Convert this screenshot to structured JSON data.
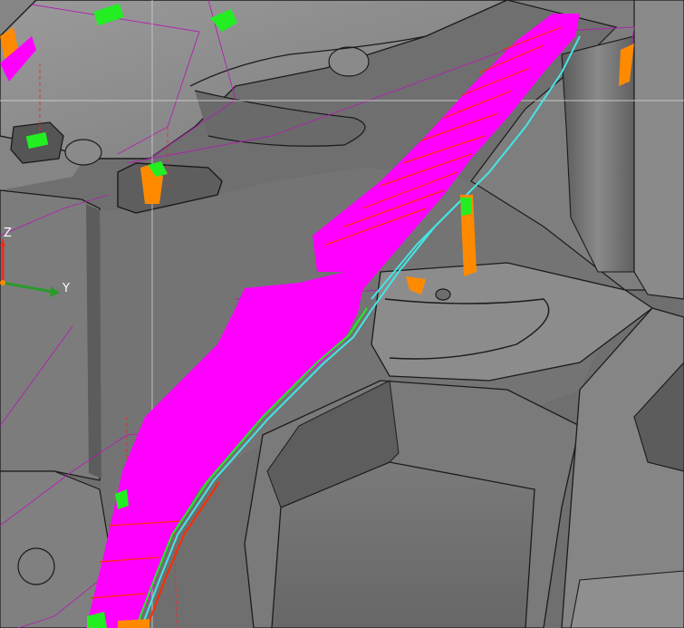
{
  "viewport": {
    "background": "#6e6e6e",
    "surface_light": "#8c8c8c",
    "surface_mid": "#7a7a7a",
    "surface_dark": "#545454",
    "edge_color": "#1a1a1a"
  },
  "toolpath": {
    "primary_color": "#ff00ff",
    "secondary_color": "#ff2a00",
    "accent_green": "#22ee22",
    "accent_orange": "#ff8a00",
    "accent_cyan": "#44e6e6"
  },
  "axis_triad": {
    "z_label": "Z",
    "y_label": "Y",
    "z_color": "#e03030",
    "y_color": "#2a9a2a"
  }
}
